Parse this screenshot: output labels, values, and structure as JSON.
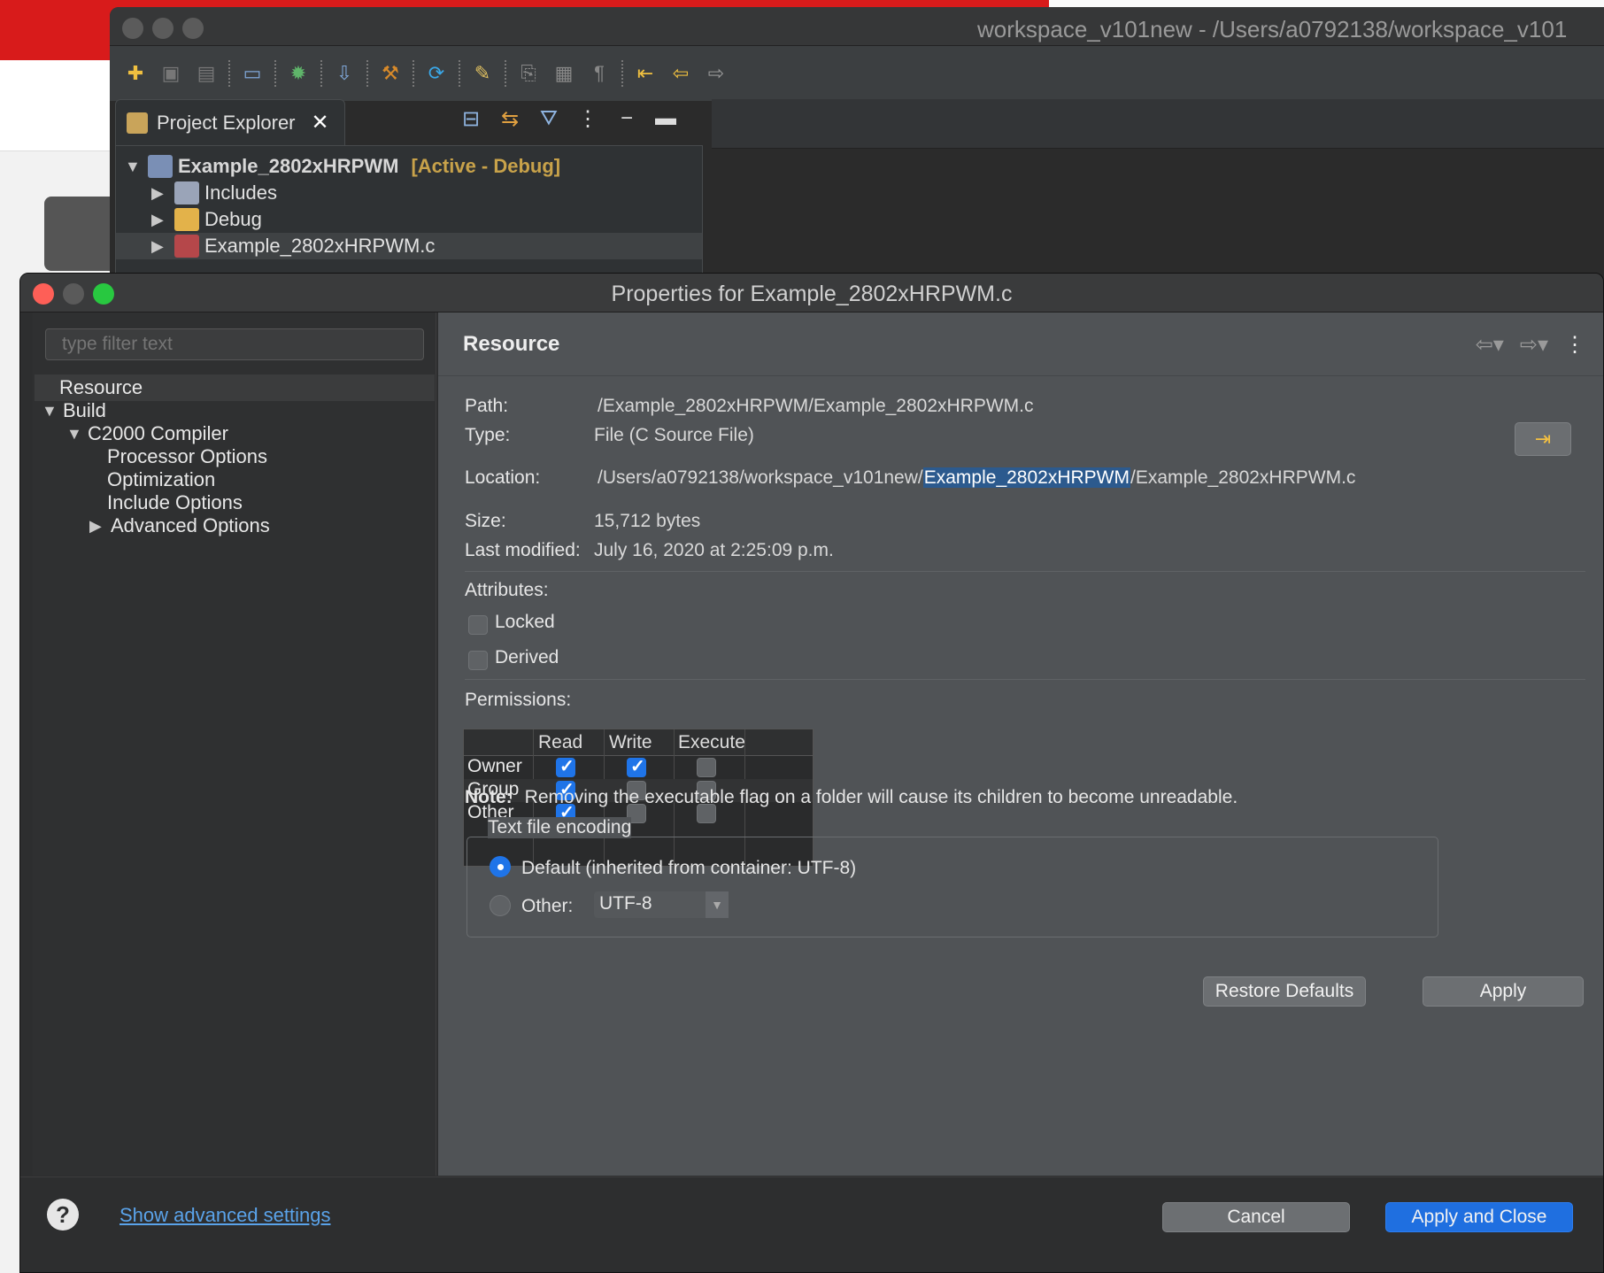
{
  "ide": {
    "window_title": "workspace_v101new - /Users/a0792138/workspace_v101",
    "explorer_tab": "Project Explorer",
    "tree": [
      {
        "label": "Example_2802xHRPWM",
        "tag": "[Active - Debug]"
      },
      {
        "label": "Includes"
      },
      {
        "label": "Debug"
      },
      {
        "label": "Example_2802xHRPWM.c"
      }
    ]
  },
  "dialog": {
    "title": "Properties for Example_2802xHRPWM.c",
    "filter_placeholder": "type filter text",
    "nav": [
      {
        "label": "Resource"
      },
      {
        "label": "Build"
      },
      {
        "label": "C2000 Compiler"
      },
      {
        "label": "Processor Options"
      },
      {
        "label": "Optimization"
      },
      {
        "label": "Include Options"
      },
      {
        "label": "Advanced Options"
      }
    ],
    "section_title": "Resource",
    "path_label": "Path:",
    "path_value": "/Example_2802xHRPWM/Example_2802xHRPWM.c",
    "type_label": "Type:",
    "type_value": "File  (C Source File)",
    "location_label": "Location:",
    "location_prefix": "/Users/a0792138/workspace_v101new/",
    "location_highlight": "Example_2802xHRPWM",
    "location_suffix": "/Example_2802xHRPWM.c",
    "size_label": "Size:",
    "size_value": "15,712  bytes",
    "modified_label": "Last modified:",
    "modified_value": "July 16, 2020 at 2:25:09 p.m.",
    "attributes_label": "Attributes:",
    "locked_label": "Locked",
    "locked_checked": false,
    "derived_label": "Derived",
    "derived_checked": false,
    "permissions_label": "Permissions:",
    "perm_columns": [
      "Read",
      "Write",
      "Execute"
    ],
    "perm_rows": [
      {
        "label": "Owner",
        "read": true,
        "write": true,
        "execute": false
      },
      {
        "label": "Group",
        "read": true,
        "write": false,
        "execute": false
      },
      {
        "label": "Other",
        "read": true,
        "write": false,
        "execute": false
      }
    ],
    "note_label": "Note:",
    "note_text": "Removing the executable flag on a folder will cause its children to become unreadable.",
    "encoding_legend": "Text file encoding",
    "encoding_default_label": "Default (inherited from container: UTF-8)",
    "encoding_default_selected": true,
    "encoding_other_label": "Other:",
    "encoding_other_value": "UTF-8",
    "restore_defaults": "Restore Defaults",
    "apply": "Apply",
    "advanced_link": "Show advanced settings",
    "cancel": "Cancel",
    "apply_and_close": "Apply and Close"
  }
}
